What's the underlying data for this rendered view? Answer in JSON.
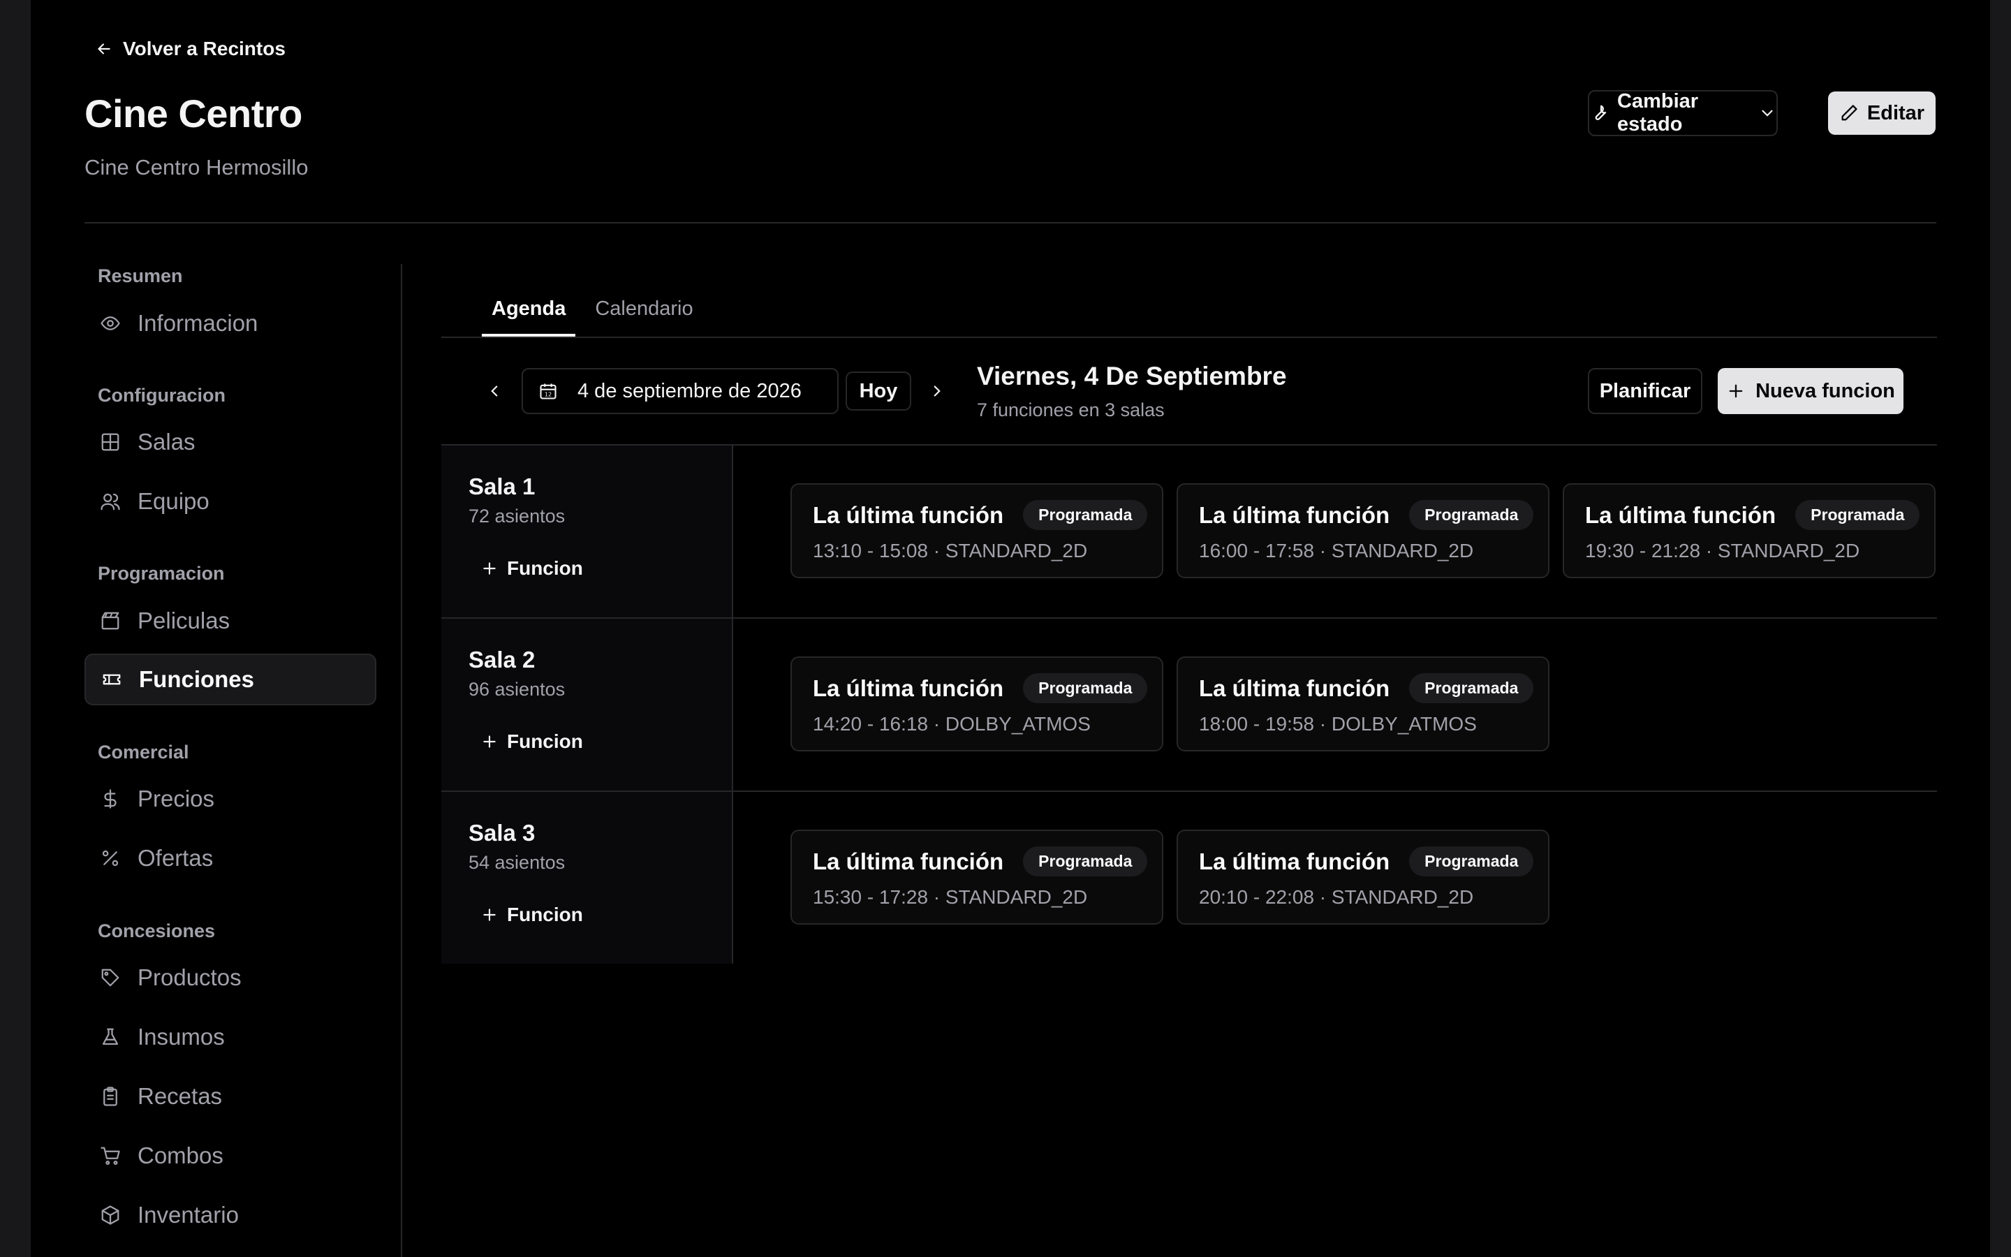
{
  "header": {
    "back_label": "Volver a Recintos",
    "title": "Cine Centro",
    "subtitle": "Cine Centro Hermosillo",
    "state_button": "Cambiar estado",
    "edit_button": "Editar"
  },
  "sidebar": {
    "groups": [
      {
        "title": "Resumen",
        "items": [
          {
            "label": "Informacion",
            "icon": "eye-icon"
          }
        ]
      },
      {
        "title": "Configuracion",
        "items": [
          {
            "label": "Salas",
            "icon": "grid-icon"
          },
          {
            "label": "Equipo",
            "icon": "users-icon"
          }
        ]
      },
      {
        "title": "Programacion",
        "items": [
          {
            "label": "Peliculas",
            "icon": "clapperboard-icon"
          },
          {
            "label": "Funciones",
            "icon": "ticket-icon",
            "active": true
          }
        ]
      },
      {
        "title": "Comercial",
        "items": [
          {
            "label": "Precios",
            "icon": "dollar-icon"
          },
          {
            "label": "Ofertas",
            "icon": "percent-icon"
          }
        ]
      },
      {
        "title": "Concesiones",
        "items": [
          {
            "label": "Productos",
            "icon": "tag-icon"
          },
          {
            "label": "Insumos",
            "icon": "flask-icon"
          },
          {
            "label": "Recetas",
            "icon": "clipboard-icon"
          },
          {
            "label": "Combos",
            "icon": "cart-icon"
          },
          {
            "label": "Inventario",
            "icon": "box-icon"
          }
        ]
      }
    ]
  },
  "tabs": [
    {
      "label": "Agenda",
      "active": true
    },
    {
      "label": "Calendario",
      "active": false
    }
  ],
  "toolbar": {
    "date_value": "4 de septiembre de 2026",
    "today_label": "Hoy",
    "day_title": "Viernes, 4 De Septiembre",
    "day_summary": "7 funciones en 3 salas",
    "plan_label": "Planificar",
    "new_label": "Nueva funcion"
  },
  "salas": [
    {
      "name": "Sala 1",
      "seats": "72 asientos",
      "add_label": "Funcion",
      "functions": [
        {
          "title": "La última función",
          "status": "Programada",
          "meta": "13:10 - 15:08 · STANDARD_2D"
        },
        {
          "title": "La última función",
          "status": "Programada",
          "meta": "16:00 - 17:58 · STANDARD_2D"
        },
        {
          "title": "La última función",
          "status": "Programada",
          "meta": "19:30 - 21:28 · STANDARD_2D"
        }
      ]
    },
    {
      "name": "Sala 2",
      "seats": "96 asientos",
      "add_label": "Funcion",
      "functions": [
        {
          "title": "La última función",
          "status": "Programada",
          "meta": "14:20 - 16:18 · DOLBY_ATMOS"
        },
        {
          "title": "La última función",
          "status": "Programada",
          "meta": "18:00 - 19:58 · DOLBY_ATMOS"
        }
      ]
    },
    {
      "name": "Sala 3",
      "seats": "54 asientos",
      "add_label": "Funcion",
      "functions": [
        {
          "title": "La última función",
          "status": "Programada",
          "meta": "15:30 - 17:28 · STANDARD_2D"
        },
        {
          "title": "La última función",
          "status": "Programada",
          "meta": "20:10 - 22:08 · STANDARD_2D"
        }
      ]
    }
  ]
}
